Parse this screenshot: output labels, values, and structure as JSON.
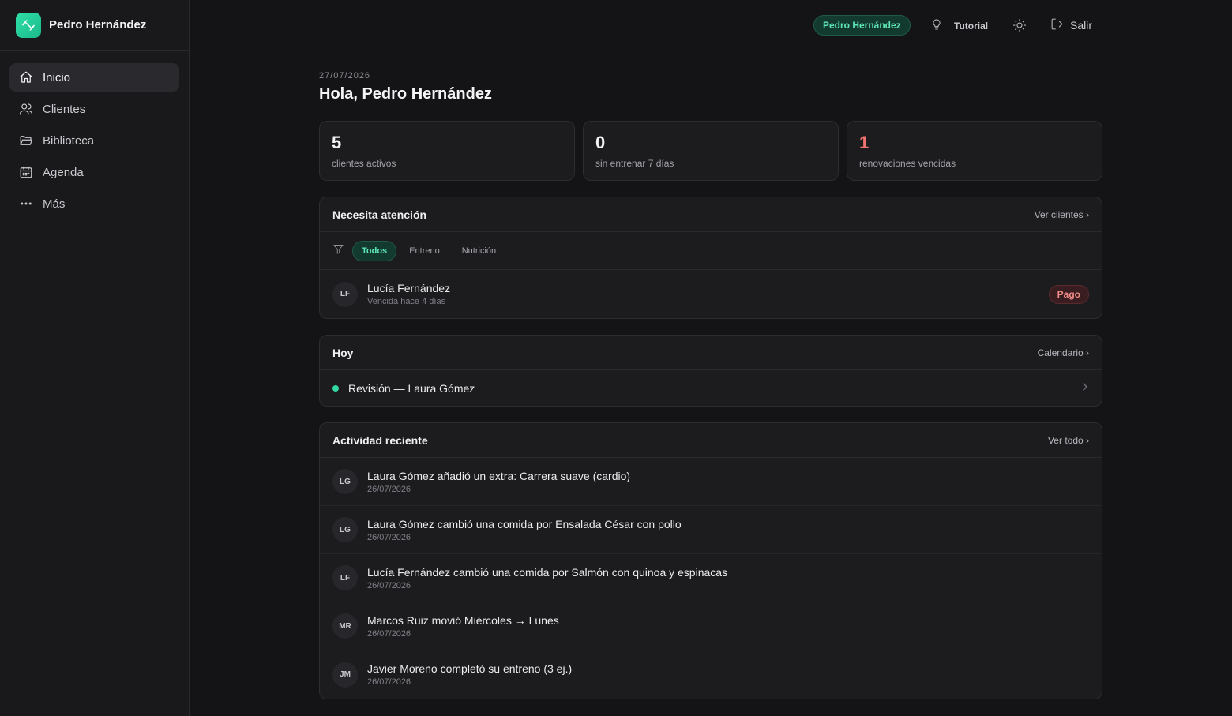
{
  "brand": {
    "name": "Pedro Hernández",
    "logo_icon": "dumbbell-icon",
    "accent": "#2fe0a8"
  },
  "sidebar": {
    "items": [
      {
        "label": "Inicio",
        "icon": "home-icon",
        "active": true
      },
      {
        "label": "Clientes",
        "icon": "users-icon",
        "active": false
      },
      {
        "label": "Biblioteca",
        "icon": "folder-icon",
        "active": false
      },
      {
        "label": "Agenda",
        "icon": "calendar-icon",
        "active": false
      },
      {
        "label": "Más",
        "icon": "more-icon",
        "active": false
      }
    ]
  },
  "topbar": {
    "user_badge": "Pedro Hernández",
    "tutorial_label": "Tutorial",
    "logout_label": "Salir"
  },
  "main": {
    "date": "27/07/2026",
    "greeting": "Hola, Pedro Hernández"
  },
  "stats": [
    {
      "value": "5",
      "label": "clientes activos"
    },
    {
      "value": "0",
      "label": "sin entrenar 7 días"
    },
    {
      "value": "1",
      "label": "renovaciones vencidas",
      "color": "#f07470"
    }
  ],
  "attention": {
    "title": "Necesita atención",
    "link": "Ver clientes ›",
    "filters": [
      "Todos",
      "Entreno",
      "Nutrición"
    ],
    "active_filter": "Todos",
    "items": [
      {
        "initials": "LF",
        "name": "Lucía Fernández",
        "detail": "Vencida hace 4 días",
        "badge": "Pago"
      }
    ]
  },
  "today": {
    "title": "Hoy",
    "link": "Calendario ›",
    "items": [
      {
        "title": "Revisión — Laura Gómez"
      }
    ]
  },
  "activity": {
    "title": "Actividad reciente",
    "link": "Ver todo ›",
    "items": [
      {
        "initials": "LG",
        "text": "Laura Gómez añadió un extra: Carrera suave (cardio)",
        "date": "26/07/2026"
      },
      {
        "initials": "LG",
        "text": "Laura Gómez cambió una comida por Ensalada César con pollo",
        "date": "26/07/2026"
      },
      {
        "initials": "LF",
        "text": "Lucía Fernández cambió una comida por Salmón con quinoa y espinacas",
        "date": "26/07/2026"
      },
      {
        "initials": "MR",
        "text": "Marcos Ruiz movió Miércoles → Lunes",
        "date": "26/07/2026"
      },
      {
        "initials": "JM",
        "text": "Javier Moreno completó su entreno (3 ej.)",
        "date": "26/07/2026"
      }
    ]
  }
}
